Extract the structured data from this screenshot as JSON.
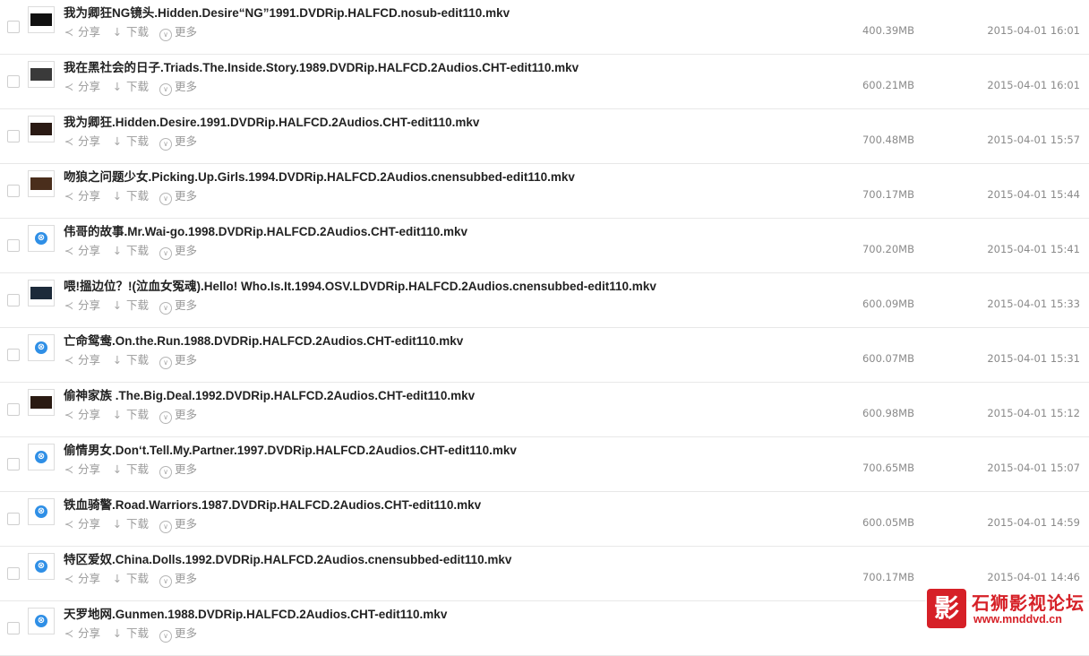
{
  "actions": {
    "share_label": "分享",
    "download_label": "下载",
    "more_label": "更多",
    "share_icon": "share-icon",
    "download_icon": "download-arrow-icon",
    "more_icon": "more-circle-icon"
  },
  "files": [
    {
      "name": "我为卿狂NG镜头.Hidden.Desire“NG”1991.DVDRip.HALFCD.nosub-edit110.mkv",
      "size": "400.39MB",
      "date": "2015-04-01 16:01",
      "thumb": "image"
    },
    {
      "name": "我在黑社会的日子.Triads.The.Inside.Story.1989.DVDRip.HALFCD.2Audios.CHT-edit110.mkv",
      "size": "600.21MB",
      "date": "2015-04-01 16:01",
      "thumb": "image"
    },
    {
      "name": "我为卿狂.Hidden.Desire.1991.DVDRip.HALFCD.2Audios.CHT-edit110.mkv",
      "size": "700.48MB",
      "date": "2015-04-01 15:57",
      "thumb": "image"
    },
    {
      "name": "吻狼之问题少女.Picking.Up.Girls.1994.DVDRip.HALFCD.2Audios.cnensubbed-edit110.mkv",
      "size": "700.17MB",
      "date": "2015-04-01 15:44",
      "thumb": "image"
    },
    {
      "name": "伟哥的故事.Mr.Wai-go.1998.DVDRip.HALFCD.2Audios.CHT-edit110.mkv",
      "size": "700.20MB",
      "date": "2015-04-01 15:41",
      "thumb": "video-icon"
    },
    {
      "name": "喂!搵边位？!(泣血女冤魂).Hello! Who.Is.It.1994.OSV.LDVDRip.HALFCD.2Audios.cnensubbed-edit110.mkv",
      "size": "600.09MB",
      "date": "2015-04-01 15:33",
      "thumb": "image"
    },
    {
      "name": "亡命鸳鸯.On.the.Run.1988.DVDRip.HALFCD.2Audios.CHT-edit110.mkv",
      "size": "600.07MB",
      "date": "2015-04-01 15:31",
      "thumb": "video-icon"
    },
    {
      "name": "偷神家族 .The.Big.Deal.1992.DVDRip.HALFCD.2Audios.CHT-edit110.mkv",
      "size": "600.98MB",
      "date": "2015-04-01 15:12",
      "thumb": "image"
    },
    {
      "name": "偷情男女.Don‘t.Tell.My.Partner.1997.DVDRip.HALFCD.2Audios.CHT-edit110.mkv",
      "size": "700.65MB",
      "date": "2015-04-01 15:07",
      "thumb": "video-icon"
    },
    {
      "name": "铁血骑警.Road.Warriors.1987.DVDRip.HALFCD.2Audios.CHT-edit110.mkv",
      "size": "600.05MB",
      "date": "2015-04-01 14:59",
      "thumb": "video-icon"
    },
    {
      "name": "特区爱奴.China.Dolls.1992.DVDRip.HALFCD.2Audios.cnensubbed-edit110.mkv",
      "size": "700.17MB",
      "date": "2015-04-01 14:46",
      "thumb": "video-icon"
    },
    {
      "name": "天罗地网.Gunmen.1988.DVDRip.HALFCD.2Audios.CHT-edit110.mkv",
      "size": "",
      "date": "",
      "thumb": "video-icon"
    }
  ],
  "watermark": {
    "logo_char": "影",
    "title": "石狮影视论坛",
    "url": "www.mnddvd.cn"
  },
  "colors": {
    "accent": "#2f8fe6",
    "watermark_red": "#d62027",
    "row_border": "#e8e8e8",
    "meta_text": "#8a8a8a"
  }
}
